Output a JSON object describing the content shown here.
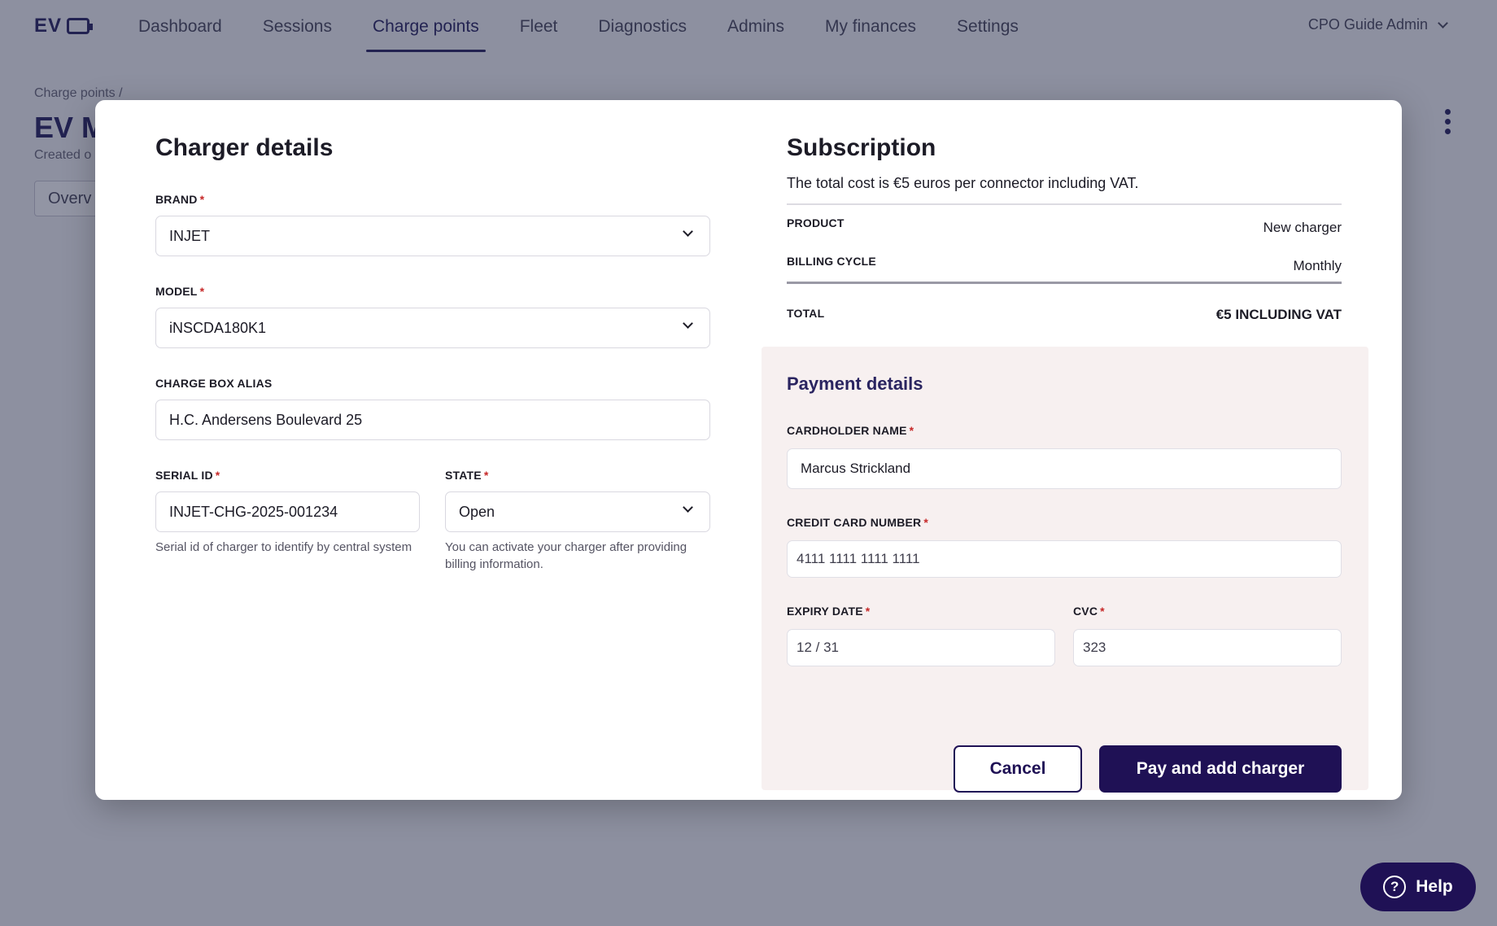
{
  "app": {
    "logo": "EV"
  },
  "nav": {
    "items": [
      {
        "label": "Dashboard"
      },
      {
        "label": "Sessions"
      },
      {
        "label": "Charge points"
      },
      {
        "label": "Fleet"
      },
      {
        "label": "Diagnostics"
      },
      {
        "label": "Admins"
      },
      {
        "label": "My finances"
      },
      {
        "label": "Settings"
      }
    ],
    "active": "Charge points",
    "user": "CPO Guide Admin"
  },
  "background": {
    "breadcrumb": "Charge points /",
    "title": "EV M",
    "created": "Created o",
    "tab": "Overv"
  },
  "charger": {
    "heading": "Charger details",
    "brand": {
      "label": "BRAND",
      "value": "INJET"
    },
    "model": {
      "label": "MODEL",
      "value": "iNSCDA180K1"
    },
    "alias": {
      "label": "CHARGE BOX ALIAS",
      "value": "H.C. Andersens Boulevard 25"
    },
    "serial": {
      "label": "SERIAL ID",
      "value": "INJET-CHG-2025-001234",
      "hint": "Serial id of charger to identify by central system"
    },
    "state": {
      "label": "STATE",
      "value": "Open",
      "hint": "You can activate your charger after providing billing information."
    },
    "required_mark": "*"
  },
  "subscription": {
    "heading": "Subscription",
    "description": "The total cost is €5 euros per connector including VAT.",
    "rows": [
      {
        "label": "PRODUCT",
        "value": "New charger"
      },
      {
        "label": "BILLING CYCLE",
        "value": "Monthly"
      }
    ],
    "total": {
      "label": "TOTAL",
      "value": "€5 INCLUDING VAT"
    }
  },
  "payment": {
    "heading": "Payment details",
    "cardholder": {
      "label": "CARDHOLDER NAME",
      "value": "Marcus Strickland"
    },
    "card_number": {
      "label": "CREDIT CARD NUMBER",
      "value": "4111 1111 1111 1111"
    },
    "expiry": {
      "label": "EXPIRY DATE",
      "value": "12 / 31"
    },
    "cvc": {
      "label": "CVC",
      "value": "323"
    },
    "cancel_label": "Cancel",
    "pay_label": "Pay and add charger"
  },
  "help": {
    "label": "Help",
    "icon": "?"
  },
  "colors": {
    "brand": "#1f1155",
    "required": "#c62828",
    "payment_bg": "#f7f0f0"
  }
}
